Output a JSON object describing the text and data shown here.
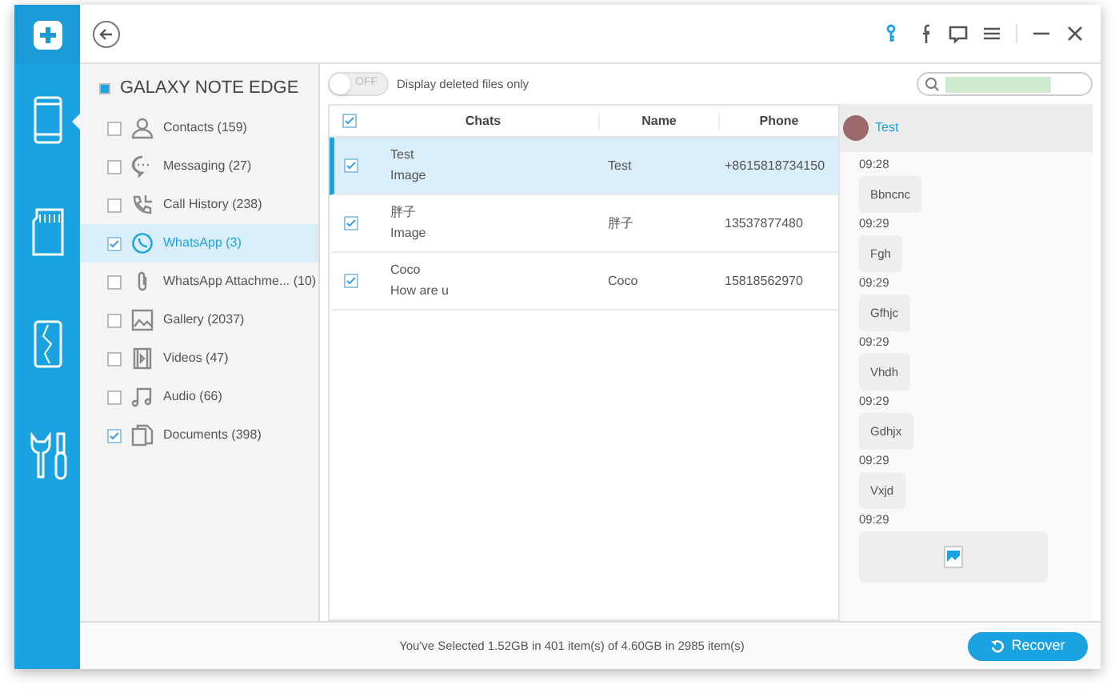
{
  "nav": [
    {
      "kind": "phone",
      "selected": true
    },
    {
      "kind": "sdcard",
      "selected": false
    },
    {
      "kind": "repair",
      "selected": false
    },
    {
      "kind": "tools",
      "selected": false
    }
  ],
  "device": {
    "name": "GALAXY NOTE EDGE",
    "partial": true
  },
  "categories": [
    {
      "kind": "contacts",
      "label": "Contacts (159)",
      "checked": false,
      "selected": false
    },
    {
      "kind": "messaging",
      "label": "Messaging (27)",
      "checked": false,
      "selected": false
    },
    {
      "kind": "call",
      "label": "Call History (238)",
      "checked": false,
      "selected": false
    },
    {
      "kind": "whatsapp",
      "label": "WhatsApp (3)",
      "checked": true,
      "selected": true
    },
    {
      "kind": "attachment",
      "label": "WhatsApp Attachme... (10)",
      "checked": false,
      "selected": false
    },
    {
      "kind": "gallery",
      "label": "Gallery (2037)",
      "checked": false,
      "selected": false
    },
    {
      "kind": "videos",
      "label": "Videos (47)",
      "checked": false,
      "selected": false
    },
    {
      "kind": "audio",
      "label": "Audio (66)",
      "checked": false,
      "selected": false
    },
    {
      "kind": "documents",
      "label": "Documents (398)",
      "checked": true,
      "selected": false
    }
  ],
  "toggle": {
    "label": "OFF",
    "on": false,
    "text": "Display deleted files only"
  },
  "table": {
    "header_checked": true,
    "columns": [
      "Chats",
      "Name",
      "Phone"
    ],
    "rows": [
      {
        "title": "Test",
        "preview": "Image",
        "name": "Test",
        "phone": "+8615818734150",
        "checked": true,
        "selected": true
      },
      {
        "title": "胖子",
        "preview": "Image",
        "name": "胖子",
        "phone": "13537877480",
        "checked": true,
        "selected": false
      },
      {
        "title": "Coco",
        "preview": "How are u",
        "name": "Coco",
        "phone": "15818562970",
        "checked": true,
        "selected": false
      }
    ]
  },
  "chat": {
    "contact": "Test",
    "messages": [
      {
        "time": "09:28",
        "kind": "text",
        "text": "Bbncnc"
      },
      {
        "time": "09:29",
        "kind": "text",
        "text": "Fgh"
      },
      {
        "time": "09:29",
        "kind": "text",
        "text": "Gfhjc"
      },
      {
        "time": "09:29",
        "kind": "text",
        "text": "Vhdh"
      },
      {
        "time": "09:29",
        "kind": "text",
        "text": "Gdhjx"
      },
      {
        "time": "09:29",
        "kind": "text",
        "text": "Vxjd"
      },
      {
        "time": "09:29",
        "kind": "image"
      }
    ]
  },
  "status_bar": {
    "text": "You've Selected 1.52GB in 401 item(s) of 4.60GB in 2985 item(s)",
    "button": "Recover"
  }
}
